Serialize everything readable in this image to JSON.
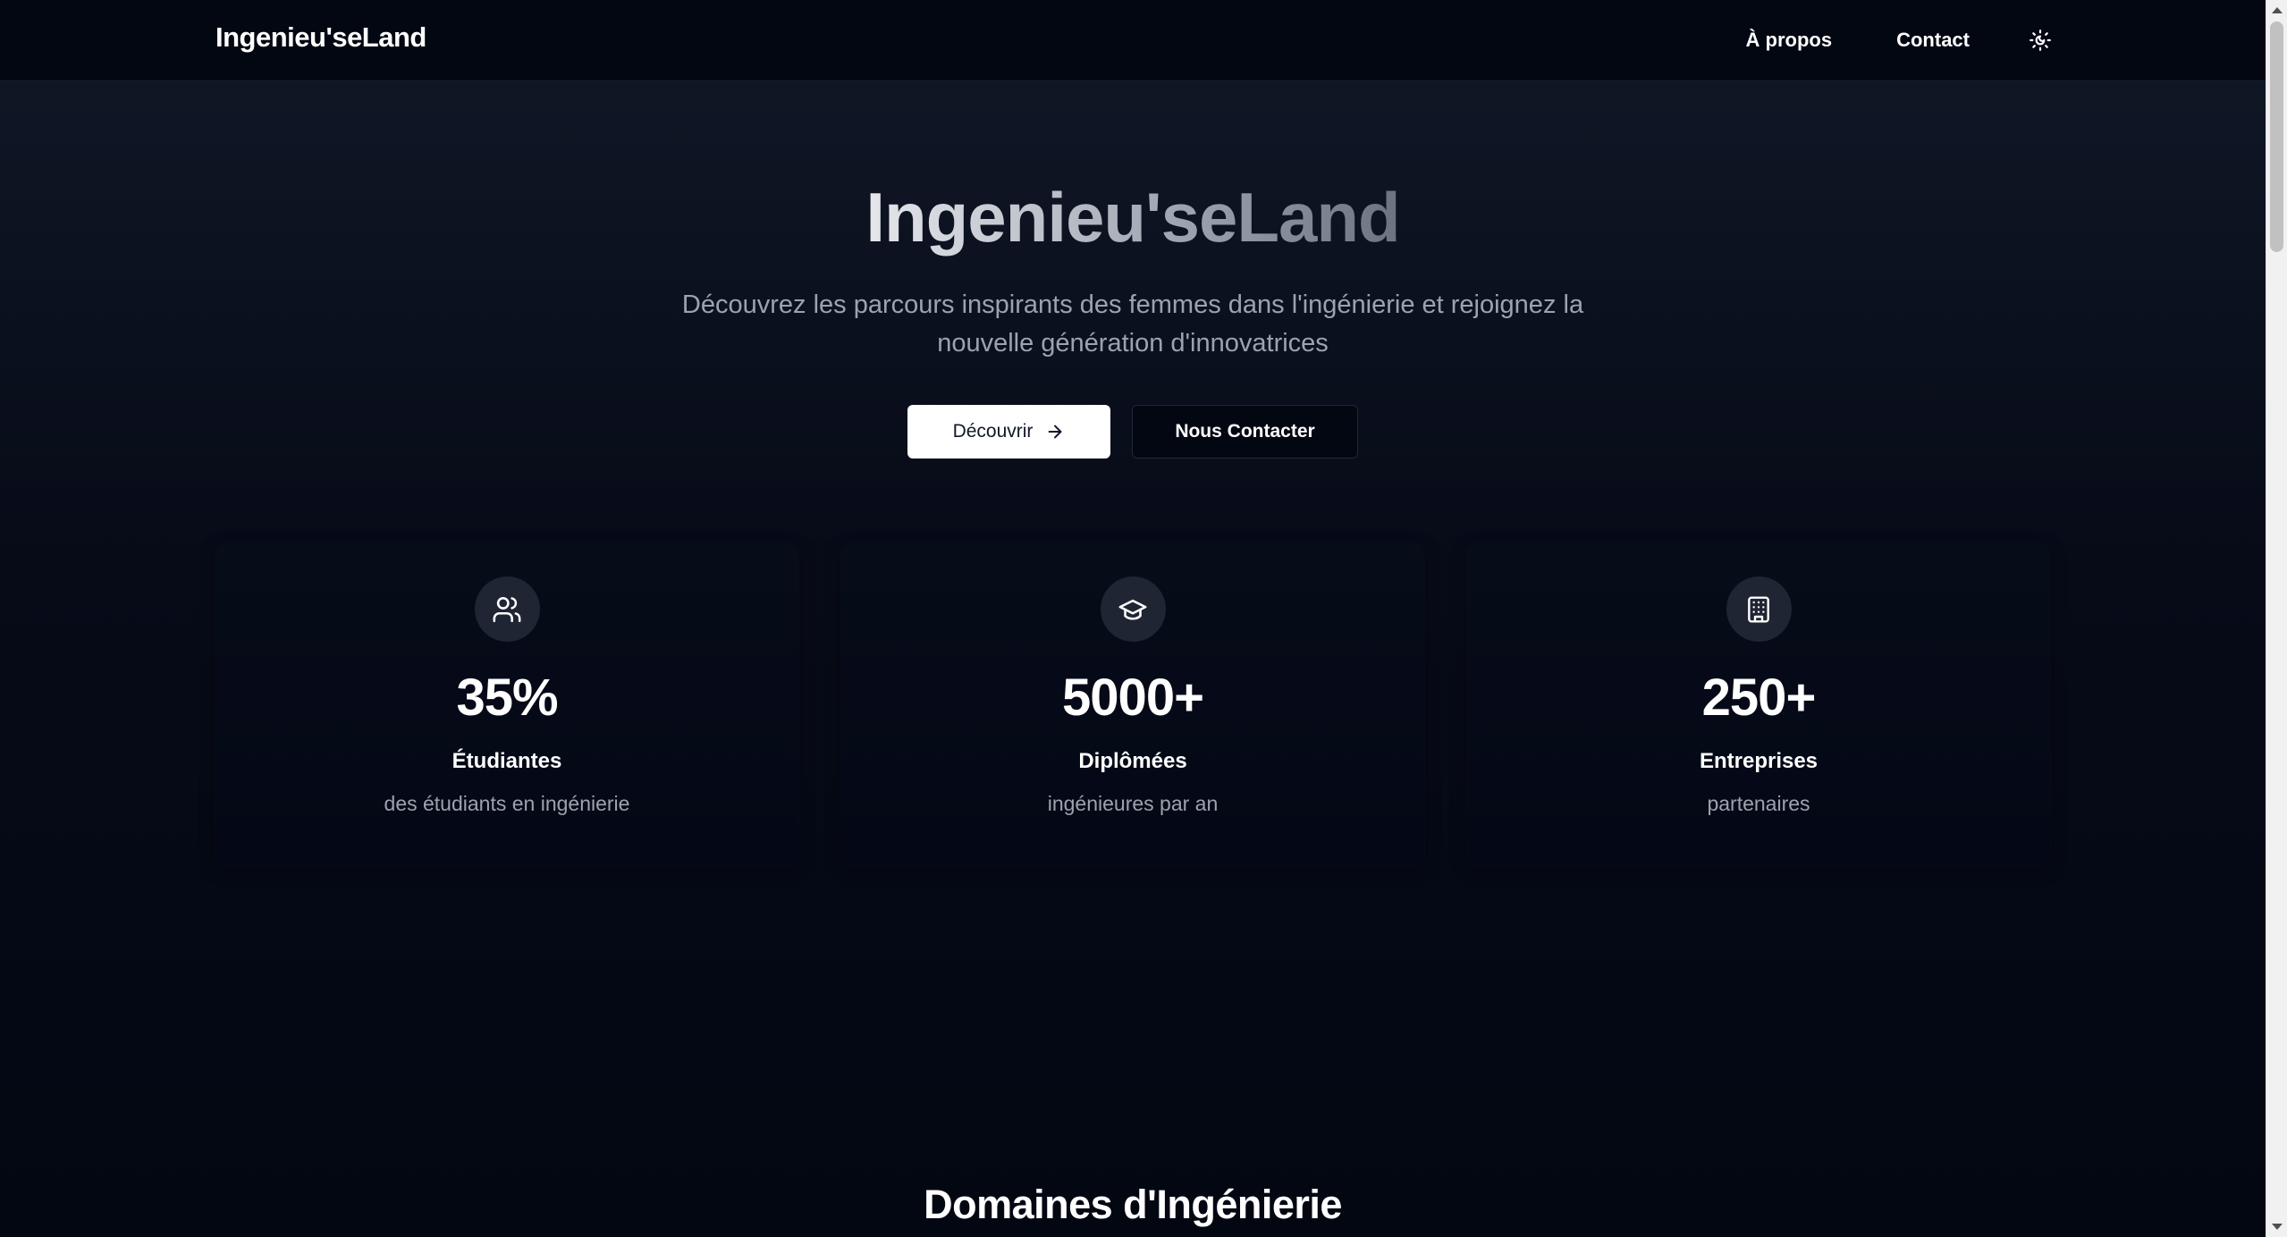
{
  "nav": {
    "brand": "Ingenieu'seLand",
    "links": [
      {
        "label": "À propos"
      },
      {
        "label": "Contact"
      }
    ],
    "theme_toggle_icon": "sun-moon-icon"
  },
  "hero": {
    "title": "Ingenieu'seLand",
    "subtitle": "Découvrez les parcours inspirants des femmes dans l'ingénierie et rejoignez la nouvelle génération d'innovatrices",
    "primary_button": "Découvrir",
    "primary_button_icon": "arrow-right-icon",
    "secondary_button": "Nous Contacter"
  },
  "stats": [
    {
      "icon": "users-icon",
      "value": "35%",
      "label": "Étudiantes",
      "desc": "des étudiants en ingénierie"
    },
    {
      "icon": "graduation-cap-icon",
      "value": "5000+",
      "label": "Diplômées",
      "desc": "ingénieures par an"
    },
    {
      "icon": "building-icon",
      "value": "250+",
      "label": "Entreprises",
      "desc": "partenaires"
    }
  ],
  "section": {
    "title": "Domaines d'Ingénierie"
  },
  "colors": {
    "background": "#030712",
    "card": "#070c19",
    "icon_circle": "#1f2533",
    "muted_text": "#9ca3af",
    "primary_button_bg": "#ffffff"
  }
}
